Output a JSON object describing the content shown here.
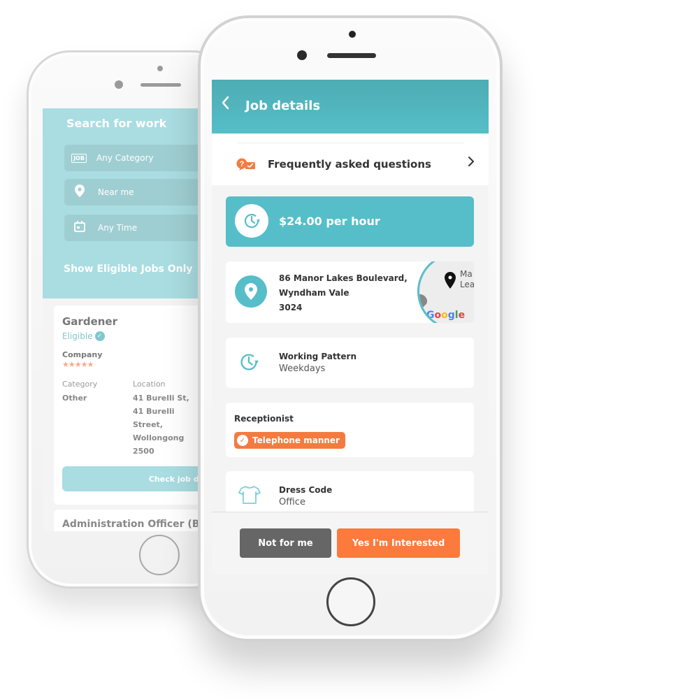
{
  "back_phone": {
    "search": {
      "title": "Search for work",
      "fields": [
        {
          "icon": "job-icon",
          "value": "Any Category"
        },
        {
          "icon": "location-pin-icon",
          "value": "Near me"
        },
        {
          "icon": "calendar-icon",
          "value": "Any Time"
        }
      ],
      "eligible_toggle_label": "Show Eligible Jobs Only"
    },
    "job_card": {
      "title": "Gardener",
      "eligibility": "Eligible",
      "company_label": "Company",
      "rating_stars": 5,
      "category_label": "Category",
      "category_value": "Other",
      "location_label": "Location",
      "location_lines": [
        "41 Burelli St,",
        "41 Burelli",
        "Street,",
        "Wollongong",
        "2500"
      ],
      "action_label": "Check job details"
    },
    "next_job_title": "Administration Officer (Band"
  },
  "front_phone": {
    "header": {
      "back_icon": "chevron-left-icon",
      "title": "Job details"
    },
    "faq": {
      "icon": "faq-icon",
      "label": "Frequently asked questions",
      "chevron": "chevron-right-icon"
    },
    "pay": {
      "icon": "clock-icon",
      "amount": "$24.00 per hour"
    },
    "address": {
      "icon": "location-pin-icon",
      "lines": [
        "86 Manor Lakes Boulevard,",
        "Wyndham Vale",
        "3024"
      ],
      "map_label_lines": [
        "Ma",
        "Lea"
      ],
      "map_brand": "Google"
    },
    "working_pattern": {
      "icon": "clock-icon",
      "title": "Working Pattern",
      "value": "Weekdays"
    },
    "skills": {
      "role": "Receptionist",
      "badges": [
        "Telephone manner"
      ]
    },
    "dress_code": {
      "icon": "tshirt-icon",
      "title": "Dress Code",
      "value": "Office"
    },
    "actions": {
      "decline_label": "Not for me",
      "accept_label": "Yes I'm Interested"
    }
  },
  "colors": {
    "primary_teal": "#56bec8",
    "accent_orange": "#fb7a3c",
    "decline_gray": "#666666",
    "star_color": "#f7a98a"
  }
}
